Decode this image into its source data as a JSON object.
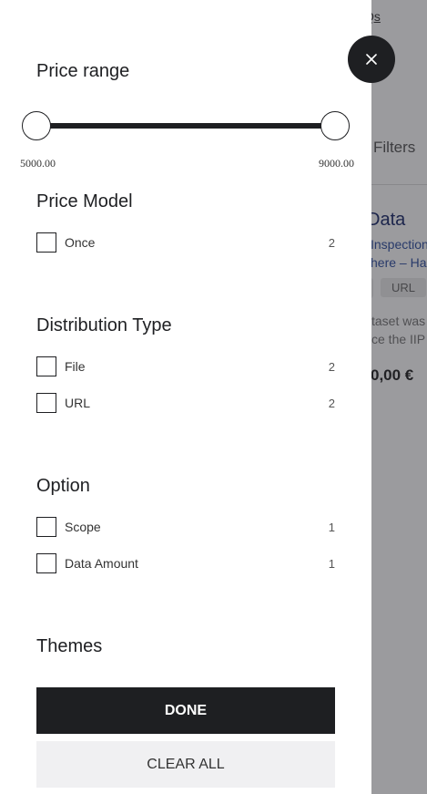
{
  "background": {
    "top_link": "Qs",
    "filters_label": "Filters",
    "card_title": "Data",
    "card_line1": "Inspection",
    "card_line2": "here – Har",
    "tag_url": "URL",
    "desc_line1": "taset was",
    "desc_line2": "ce the IIP",
    "price": "0,00 €"
  },
  "drawer": {
    "close_icon": "close-icon",
    "price_range": {
      "title": "Price range",
      "min_label": "5000.00",
      "max_label": "9000.00",
      "min": 5000.0,
      "max": 9000.0,
      "selected_min": 5000.0,
      "selected_max": 9000.0
    },
    "price_model": {
      "title": "Price Model",
      "options": [
        {
          "label": "Once",
          "count": "2"
        }
      ]
    },
    "distribution_type": {
      "title": "Distribution Type",
      "options": [
        {
          "label": "File",
          "count": "2"
        },
        {
          "label": "URL",
          "count": "2"
        }
      ]
    },
    "option": {
      "title": "Option",
      "options": [
        {
          "label": "Scope",
          "count": "1"
        },
        {
          "label": "Data Amount",
          "count": "1"
        }
      ]
    },
    "themes": {
      "title": "Themes"
    },
    "done_label": "DONE",
    "clear_all_label": "CLEAR ALL"
  },
  "colors": {
    "primary": "#1e1f22",
    "overlay": "rgba(33,33,40,0.45)",
    "clear_bg": "#f0f0f2"
  }
}
